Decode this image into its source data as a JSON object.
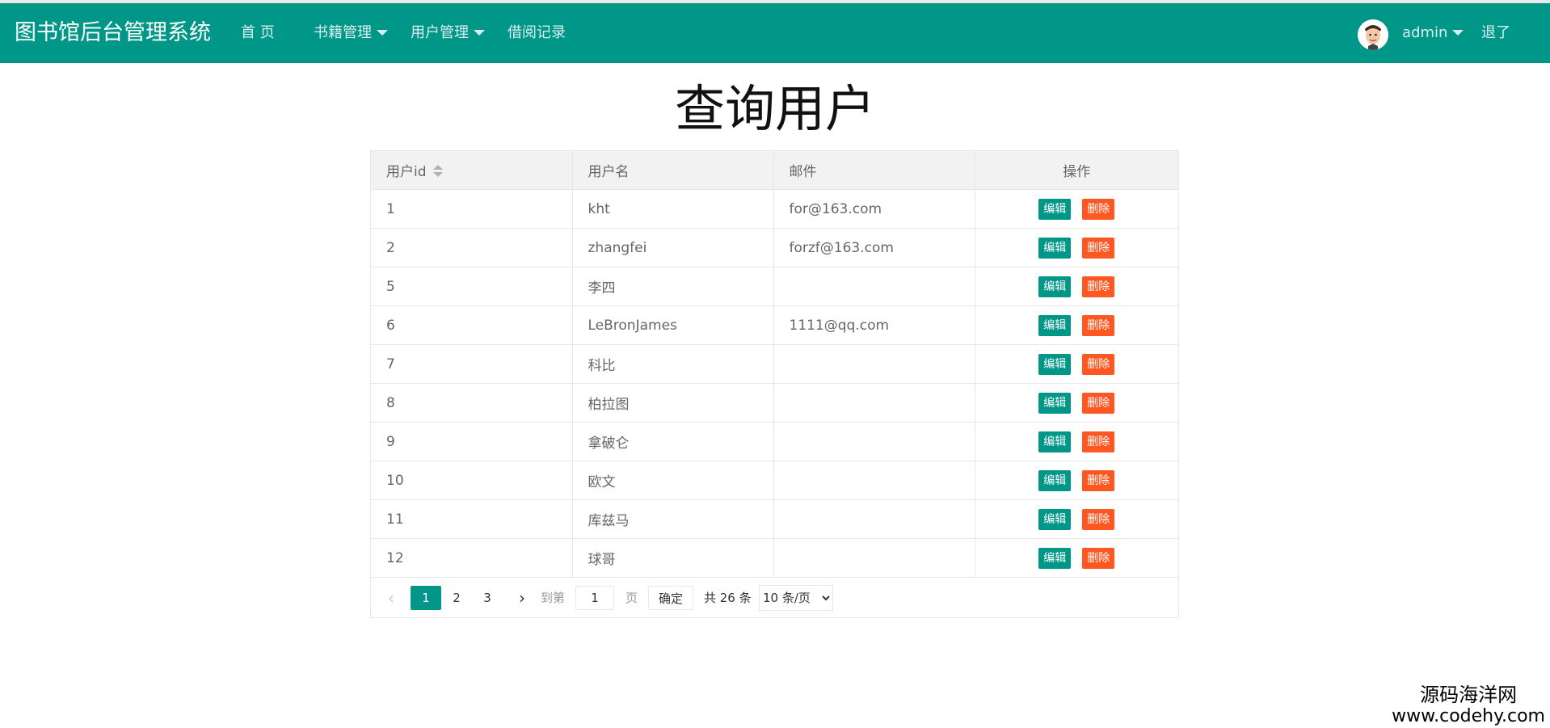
{
  "header": {
    "brand": "图书馆后台管理系统",
    "nav": [
      {
        "label": "首 页"
      },
      {
        "label": "书籍管理"
      },
      {
        "label": "用户管理"
      },
      {
        "label": "借阅记录"
      }
    ],
    "user_name": "admin",
    "logout_label": "退了"
  },
  "page": {
    "title": "查询用户"
  },
  "table": {
    "columns": [
      "用户id",
      "用户名",
      "邮件",
      "操作"
    ],
    "edit_label": "编辑",
    "delete_label": "删除",
    "rows": [
      {
        "id": "1",
        "username": "kht",
        "email": "for@163.com"
      },
      {
        "id": "2",
        "username": "zhangfei",
        "email": "forzf@163.com"
      },
      {
        "id": "5",
        "username": "李四",
        "email": ""
      },
      {
        "id": "6",
        "username": "LeBronJames",
        "email": "1111@qq.com"
      },
      {
        "id": "7",
        "username": "科比",
        "email": ""
      },
      {
        "id": "8",
        "username": "柏拉图",
        "email": ""
      },
      {
        "id": "9",
        "username": "拿破仑",
        "email": ""
      },
      {
        "id": "10",
        "username": "欧文",
        "email": ""
      },
      {
        "id": "11",
        "username": "库兹马",
        "email": ""
      },
      {
        "id": "12",
        "username": "球哥",
        "email": ""
      }
    ]
  },
  "pagination": {
    "pages": [
      "1",
      "2",
      "3"
    ],
    "goto_label": "到第",
    "goto_value": "1",
    "page_label": "页",
    "confirm_label": "确定",
    "total_label": "共 26 条",
    "page_size_option": "10 条/页"
  },
  "watermark": {
    "line1": "源码海洋网",
    "line2": "www.codehy.com"
  },
  "colors": {
    "header_bg": "#009688",
    "edit_button": "#009688",
    "delete_button": "#ff5722"
  }
}
